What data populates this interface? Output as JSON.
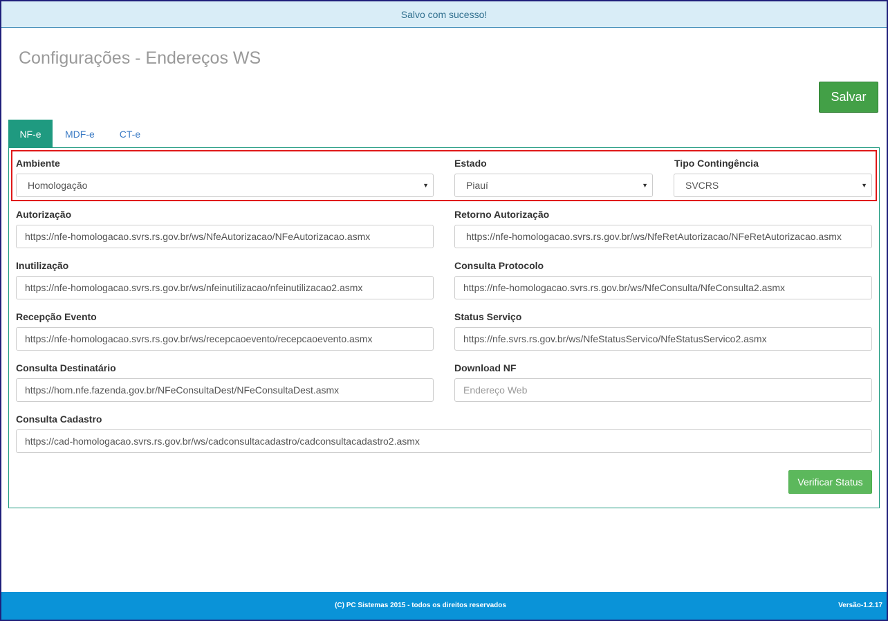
{
  "alert": {
    "message": "Salvo com sucesso!"
  },
  "page": {
    "title": "Configurações - Endereços WS"
  },
  "toolbar": {
    "save_label": "Salvar"
  },
  "tabs": [
    {
      "label": "NF-e",
      "active": true
    },
    {
      "label": "MDF-e",
      "active": false
    },
    {
      "label": "CT-e",
      "active": false
    }
  ],
  "form": {
    "ambiente": {
      "label": "Ambiente",
      "value": "Homologação"
    },
    "estado": {
      "label": "Estado",
      "value": "Piauí"
    },
    "tipo_contingencia": {
      "label": "Tipo Contingência",
      "value": "SVCRS"
    },
    "autorizacao": {
      "label": "Autorização",
      "value": "https://nfe-homologacao.svrs.rs.gov.br/ws/NfeAutorizacao/NFeAutorizacao.asmx"
    },
    "retorno_autorizacao": {
      "label": "Retorno Autorização",
      "value": "https://nfe-homologacao.svrs.rs.gov.br/ws/NfeRetAutorizacao/NFeRetAutorizacao.asmx"
    },
    "inutilizacao": {
      "label": "Inutilização",
      "value": "https://nfe-homologacao.svrs.rs.gov.br/ws/nfeinutilizacao/nfeinutilizacao2.asmx"
    },
    "consulta_protocolo": {
      "label": "Consulta Protocolo",
      "value": "https://nfe-homologacao.svrs.rs.gov.br/ws/NfeConsulta/NfeConsulta2.asmx"
    },
    "recepcao_evento": {
      "label": "Recepção Evento",
      "value": "https://nfe-homologacao.svrs.rs.gov.br/ws/recepcaoevento/recepcaoevento.asmx"
    },
    "status_servico": {
      "label": "Status Serviço",
      "value": "https://nfe.svrs.rs.gov.br/ws/NfeStatusServico/NfeStatusServico2.asmx"
    },
    "consulta_destinatario": {
      "label": "Consulta Destinatário",
      "value": "https://hom.nfe.fazenda.gov.br/NFeConsultaDest/NFeConsultaDest.asmx"
    },
    "download_nf": {
      "label": "Download NF",
      "value": "",
      "placeholder": "Endereço Web"
    },
    "consulta_cadastro": {
      "label": "Consulta Cadastro",
      "value": "https://cad-homologacao.svrs.rs.gov.br/ws/cadconsultacadastro/cadconsultacadastro2.asmx"
    }
  },
  "actions": {
    "verify_label": "Verificar Status"
  },
  "footer": {
    "copyright": "(C) PC Sistemas 2015 - todos os direitos reservados",
    "version": "Versão-1.2.17"
  },
  "colors": {
    "alert_bg": "#d9edf7",
    "success": "#43a047",
    "tab_active": "#1f9a80",
    "footer_bg": "#0a93d8",
    "highlight": "#e01818"
  }
}
